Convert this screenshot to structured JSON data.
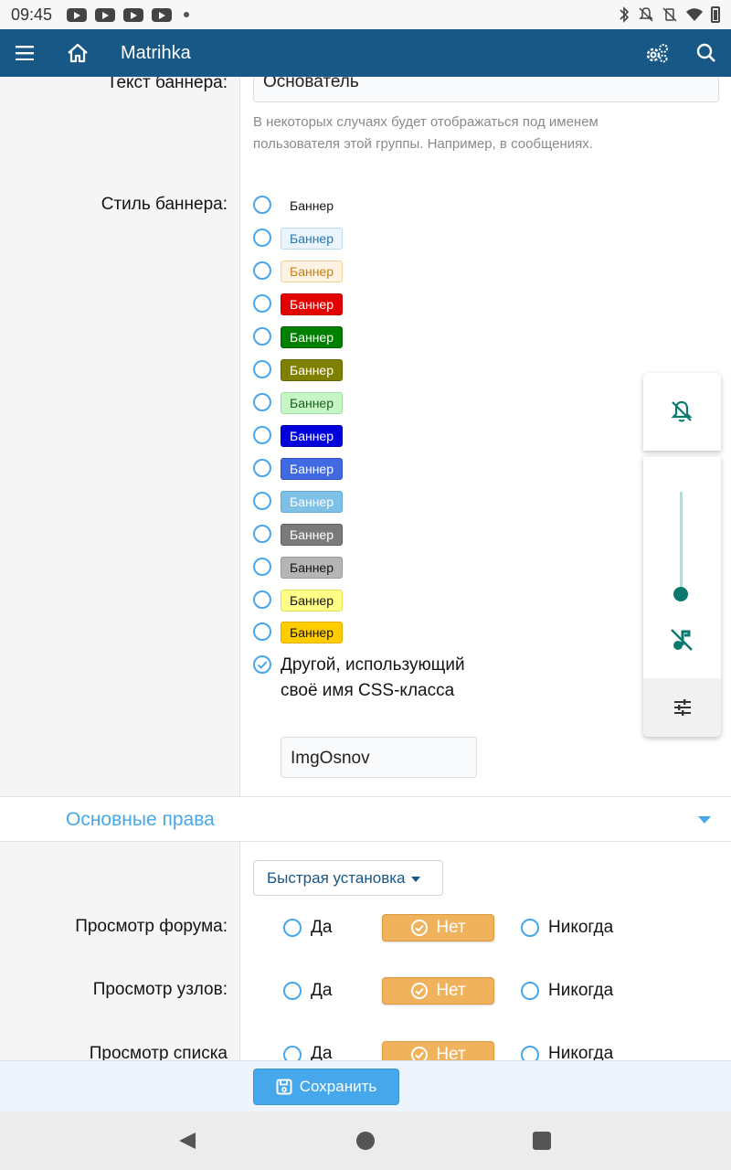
{
  "status": {
    "time": "09:45"
  },
  "appbar": {
    "title": "Matrihka"
  },
  "form": {
    "banner_text_label": "Текст баннера:",
    "banner_text_value": "Основатель",
    "banner_hint": "В некоторых случаях будет отображаться под именем пользователя этой группы. Например, в сообщениях.",
    "banner_style_label": "Стиль баннера:",
    "banner_styles": [
      {
        "label": "Баннер",
        "bg": "#ffffff",
        "fg": "#141414",
        "border": "#ffffff"
      },
      {
        "label": "Баннер",
        "bg": "#eaf4fd",
        "fg": "#2577b1",
        "border": "#b9daf3"
      },
      {
        "label": "Баннер",
        "bg": "#fef3e3",
        "fg": "#c77e15",
        "border": "#f4cf96"
      },
      {
        "label": "Баннер",
        "bg": "#e30000",
        "fg": "#ffffff",
        "border": "#c00000"
      },
      {
        "label": "Баннер",
        "bg": "#008000",
        "fg": "#ffffff",
        "border": "#006400"
      },
      {
        "label": "Баннер",
        "bg": "#808000",
        "fg": "#ffffff",
        "border": "#666600"
      },
      {
        "label": "Баннер",
        "bg": "#c6f5c6",
        "fg": "#1b5e1b",
        "border": "#9fe09f"
      },
      {
        "label": "Баннер",
        "bg": "#0000dd",
        "fg": "#ffffff",
        "border": "#0000aa"
      },
      {
        "label": "Баннер",
        "bg": "#4169e1",
        "fg": "#ffffff",
        "border": "#2f52c0"
      },
      {
        "label": "Баннер",
        "bg": "#7ec0e6",
        "fg": "#ffffff",
        "border": "#62a9d3"
      },
      {
        "label": "Баннер",
        "bg": "#7a7a7a",
        "fg": "#ffffff",
        "border": "#5e5e5e"
      },
      {
        "label": "Баннер",
        "bg": "#b5b5b5",
        "fg": "#141414",
        "border": "#999999"
      },
      {
        "label": "Баннер",
        "bg": "#ffff88",
        "fg": "#141414",
        "border": "#e0e05c"
      },
      {
        "label": "Баннер",
        "bg": "#ffcc00",
        "fg": "#141414",
        "border": "#e0b000"
      }
    ],
    "other_label": "Другой, использующий своё имя CSS-класса",
    "css_class_value": "ImgOsnov"
  },
  "section": {
    "title": "Основные права"
  },
  "permissions": {
    "quick_set_label": "Быстрая установка",
    "yes_label": "Да",
    "no_label": "Нет",
    "never_label": "Никогда",
    "rows": [
      {
        "label": "Просмотр форума:"
      },
      {
        "label": "Просмотр узлов:"
      },
      {
        "label": "Просмотр списка"
      }
    ]
  },
  "save": {
    "label": "Сохранить"
  }
}
